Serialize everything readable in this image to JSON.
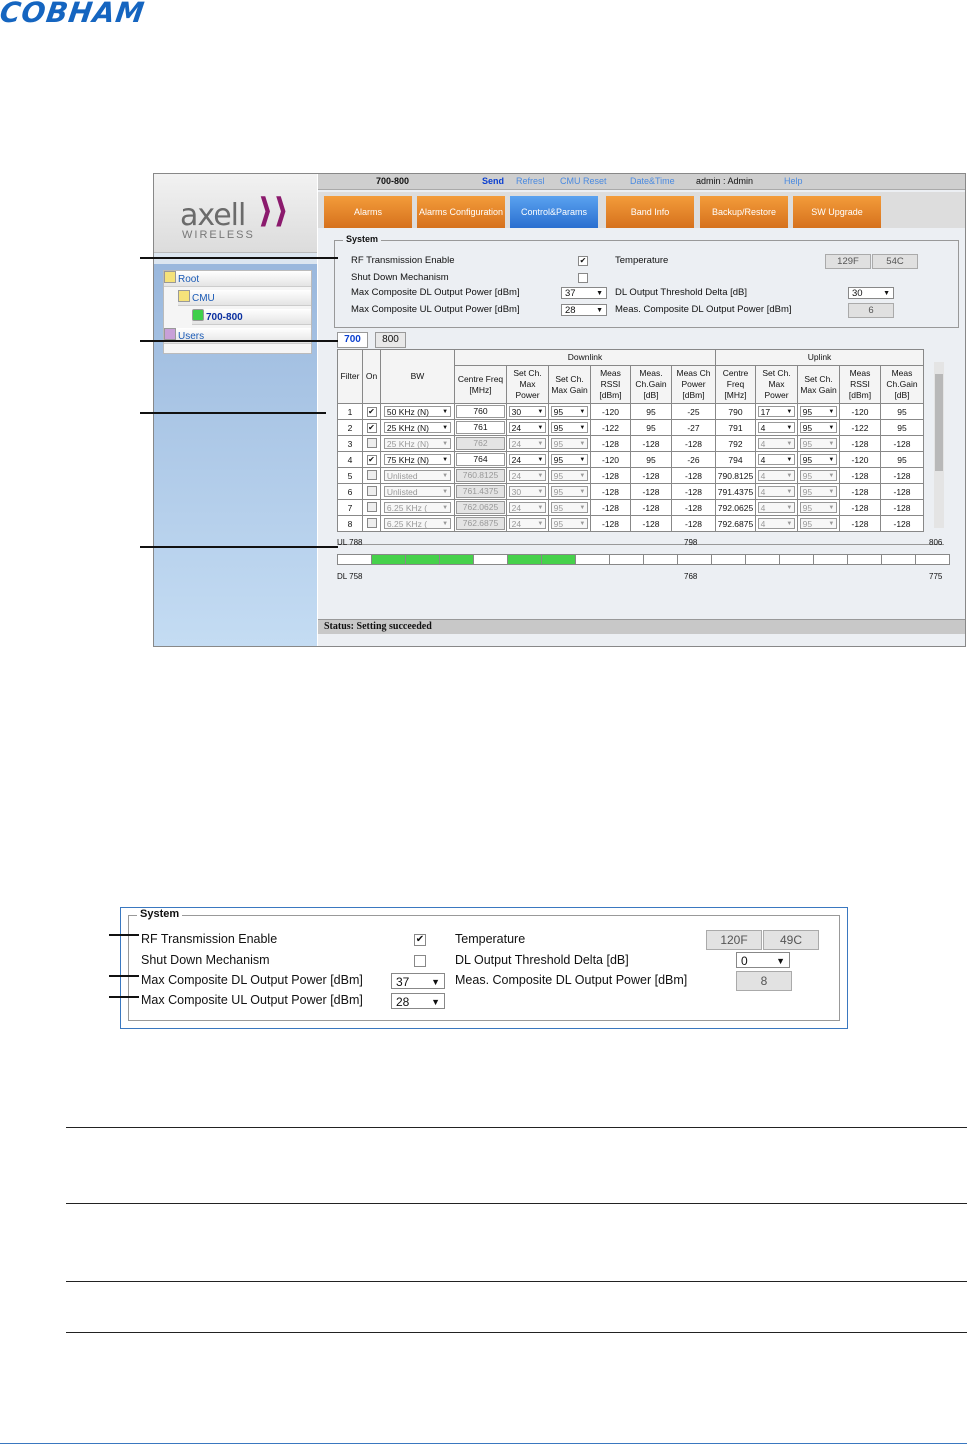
{
  "brand": {
    "cobham": "COBHAM",
    "axell": "axell",
    "wireless": "WIRELESS"
  },
  "colors": {
    "tab_orange": "#e8862a",
    "tab_active": "#3a86e0",
    "link": "#1a5ab6",
    "filter_on": "#46d14b",
    "accent": "#1565c0"
  },
  "tree": {
    "root": "Root",
    "cmu": "CMU",
    "device": "700-800",
    "users": "Users"
  },
  "topbar": {
    "device": "700-800",
    "send": "Send",
    "refresh": "Refresl",
    "cmu_reset": "CMU Reset",
    "datetime": "Date&Time",
    "user": "admin : Admin",
    "help": "Help"
  },
  "tabs": [
    "Alarms",
    "Alarms Configuration",
    "Control&Params",
    "Band Info",
    "Backup/Restore",
    "SW Upgrade"
  ],
  "system": {
    "legend": "System",
    "rf_enable": "RF Transmission Enable",
    "shutdown": "Shut Down Mechanism",
    "dl_max": "Max Composite DL Output Power [dBm]",
    "ul_max": "Max Composite UL Output Power [dBm]",
    "temperature": "Temperature",
    "dl_threshold": "DL Output Threshold Delta [dB]",
    "meas_dl": "Meas. Composite DL Output Power [dBm]",
    "temp_f": "129F",
    "temp_c": "54C",
    "dl_max_val": "37",
    "ul_max_val": "28",
    "threshold_val": "30",
    "meas_val": "6"
  },
  "bands": [
    "700",
    "800"
  ],
  "grid": {
    "h_downlink": "Downlink",
    "h_uplink": "Uplink",
    "h_filter": "Filter",
    "h_on": "On",
    "h_bw": "BW",
    "h_centre": "Centre Freq [MHz]",
    "h_set_power": "Set Ch. Max Power",
    "h_set_gain": "Set Ch. Max Gain",
    "h_meas_rssi": "Meas RSSI [dBm]",
    "h_meas_gain": "Meas. Ch.Gain [dB]",
    "h_meas_power": "Meas Ch Power [dBm]",
    "h_ul_rssi": "Meas RSSI [dBm]",
    "h_ul_gain": "Meas Ch.Gain [dB]",
    "rows": [
      {
        "f": "1",
        "bw": "50 KHz (N)",
        "dlf": "760",
        "dlp": "30",
        "dlg": "95",
        "rssi": "-120",
        "gain": "95",
        "pwr": "-25",
        "ulf": "790",
        "ulp": "17",
        "ulg": "95",
        "ulrssi": "-120",
        "ulgain": "95"
      },
      {
        "f": "2",
        "bw": "25 KHz (N)",
        "dlf": "761",
        "dlp": "24",
        "dlg": "95",
        "rssi": "-122",
        "gain": "95",
        "pwr": "-27",
        "ulf": "791",
        "ulp": "4",
        "ulg": "95",
        "ulrssi": "-122",
        "ulgain": "95"
      },
      {
        "f": "3",
        "bw": "25 KHz (N)",
        "dlf": "762",
        "dlp": "24",
        "dlg": "95",
        "rssi": "-128",
        "gain": "-128",
        "pwr": "-128",
        "ulf": "792",
        "ulp": "4",
        "ulg": "95",
        "ulrssi": "-128",
        "ulgain": "-128"
      },
      {
        "f": "4",
        "bw": "75 KHz (N)",
        "dlf": "764",
        "dlp": "24",
        "dlg": "95",
        "rssi": "-120",
        "gain": "95",
        "pwr": "-26",
        "ulf": "794",
        "ulp": "4",
        "ulg": "95",
        "ulrssi": "-120",
        "ulgain": "95"
      },
      {
        "f": "5",
        "bw": "Unlisted",
        "dlf": "760.8125",
        "dlp": "24",
        "dlg": "95",
        "rssi": "-128",
        "gain": "-128",
        "pwr": "-128",
        "ulf": "790.8125",
        "ulp": "4",
        "ulg": "95",
        "ulrssi": "-128",
        "ulgain": "-128"
      },
      {
        "f": "6",
        "bw": "Unlisted",
        "dlf": "761.4375",
        "dlp": "30",
        "dlg": "95",
        "rssi": "-128",
        "gain": "-128",
        "pwr": "-128",
        "ulf": "791.4375",
        "ulp": "4",
        "ulg": "95",
        "ulrssi": "-128",
        "ulgain": "-128"
      },
      {
        "f": "7",
        "bw": "6.25 KHz (",
        "dlf": "762.0625",
        "dlp": "24",
        "dlg": "95",
        "rssi": "-128",
        "gain": "-128",
        "pwr": "-128",
        "ulf": "792.0625",
        "ulp": "4",
        "ulg": "95",
        "ulrssi": "-128",
        "ulgain": "-128"
      },
      {
        "f": "8",
        "bw": "6.25 KHz (",
        "dlf": "762.6875",
        "dlp": "24",
        "dlg": "95",
        "rssi": "-128",
        "gain": "-128",
        "pwr": "-128",
        "ulf": "792.6875",
        "ulp": "4",
        "ulg": "95",
        "ulrssi": "-128",
        "ulgain": "-128"
      }
    ]
  },
  "spectrum": {
    "ul_start": "UL 788",
    "ul_mid": "798",
    "ul_end": "806",
    "dl_start": "DL 758",
    "dl_mid": "768",
    "dl_end": "775"
  },
  "status": "Status: Setting succeeded",
  "system2": {
    "legend": "System",
    "rf_enable": "RF Transmission Enable",
    "shutdown": "Shut Down Mechanism",
    "dl_max": "Max Composite DL Output Power [dBm]",
    "ul_max": "Max Composite UL Output Power [dBm]",
    "temperature": "Temperature",
    "dl_threshold": "DL Output Threshold Delta [dB]",
    "meas_dl": "Meas. Composite DL Output Power [dBm]",
    "temp_f": "120F",
    "temp_c": "49C",
    "dl_max_val": "37",
    "ul_max_val": "28",
    "threshold_val": "0",
    "meas_val": "8"
  }
}
